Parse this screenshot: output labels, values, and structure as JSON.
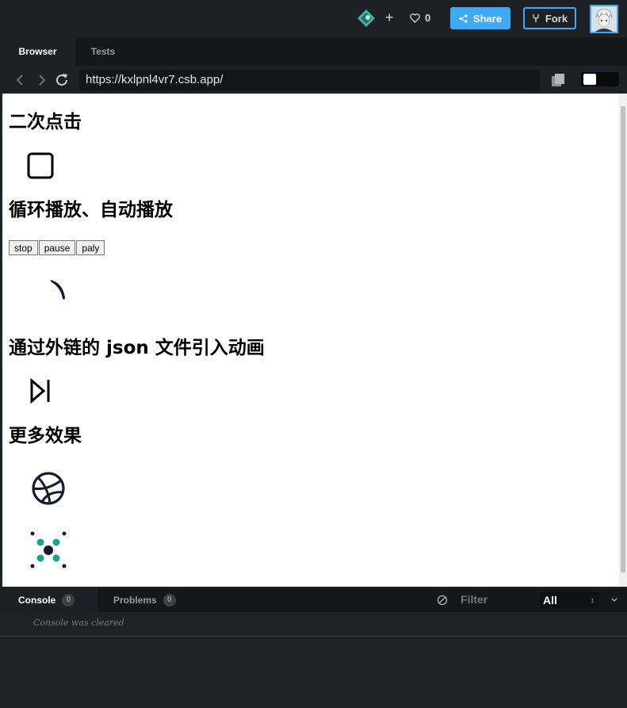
{
  "topbar": {
    "like_count": "0",
    "share_label": "Share",
    "fork_label": "Fork"
  },
  "tabs": {
    "browser": "Browser",
    "tests": "Tests"
  },
  "navbar": {
    "url": "https://kxlpnl4vr7.csb.app/"
  },
  "page": {
    "sections": [
      {
        "heading": "二次点击"
      },
      {
        "heading": "循环播放、自动播放"
      },
      {
        "heading": "通过外链的 json 文件引入动画"
      },
      {
        "heading": "更多效果"
      }
    ],
    "buttons": [
      "stop",
      "pause",
      "paly"
    ]
  },
  "console": {
    "tab_console": "Console",
    "console_count": "0",
    "tab_problems": "Problems",
    "problems_count": "0",
    "filter_placeholder": "Filter",
    "level_select": "All",
    "message": "Console was cleared"
  },
  "colors": {
    "accent": "#40a9f3",
    "teal": "#1da28d",
    "dark_icon": "#1a1a2e"
  }
}
